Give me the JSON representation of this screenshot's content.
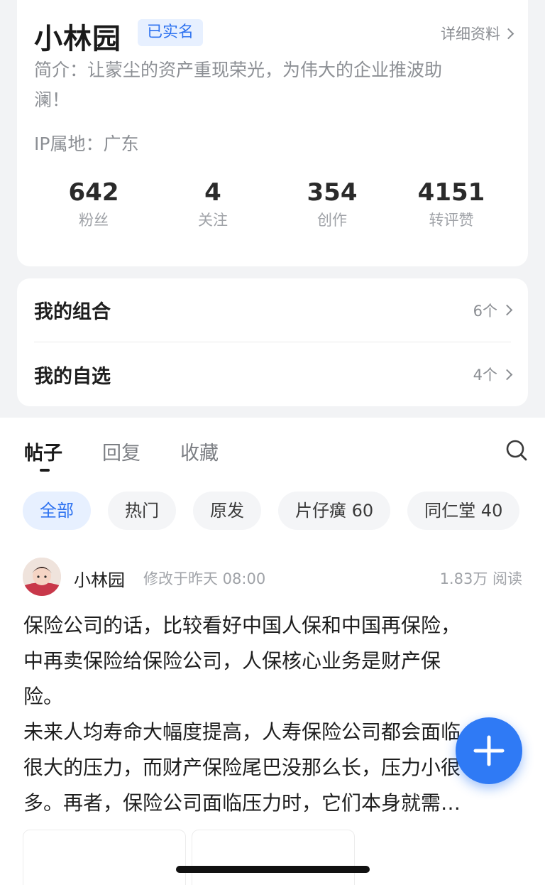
{
  "profile": {
    "name": "小林园",
    "verified_badge": "已实名",
    "detail_link": "详细资料",
    "bio_line1": "简介：让蒙尘的资产重现荣光，为伟大的企业推波助",
    "bio_line2": "澜！",
    "ip_location": "IP属地：广东",
    "stats": [
      {
        "value": "642",
        "label": "粉丝"
      },
      {
        "value": "4",
        "label": "关注"
      },
      {
        "value": "354",
        "label": "创作"
      },
      {
        "value": "4151",
        "label": "转评赞"
      }
    ]
  },
  "lists": [
    {
      "title": "我的组合",
      "count": "6个"
    },
    {
      "title": "我的自选",
      "count": "4个"
    }
  ],
  "tabs": [
    "帖子",
    "回复",
    "收藏"
  ],
  "chips": [
    "全部",
    "热门",
    "原发",
    "片仔癀 60",
    "同仁堂 40"
  ],
  "post": {
    "author": "小林园",
    "modified": "修改于昨天 08:00",
    "reads": "1.83万 阅读",
    "lines": [
      "保险公司的话，比较看好中国人保和中国再保险，",
      "中再卖保险给保险公司，人保核心业务是财产保",
      "险。",
      "未来人均寿命大幅度提高，人寿保险公司都会面临",
      "很大的压力，而财产保险尾巴没那么长，压力小很",
      "多。再者，保险公司面临压力时，它们本身就需…"
    ]
  },
  "colors": {
    "accent": "#2f73f0",
    "fab": "#2f7af5",
    "background": "#f2f3f5"
  },
  "icons": {
    "fab": "plus-icon",
    "search": "search-icon",
    "chevron": "chevron-right-icon"
  }
}
